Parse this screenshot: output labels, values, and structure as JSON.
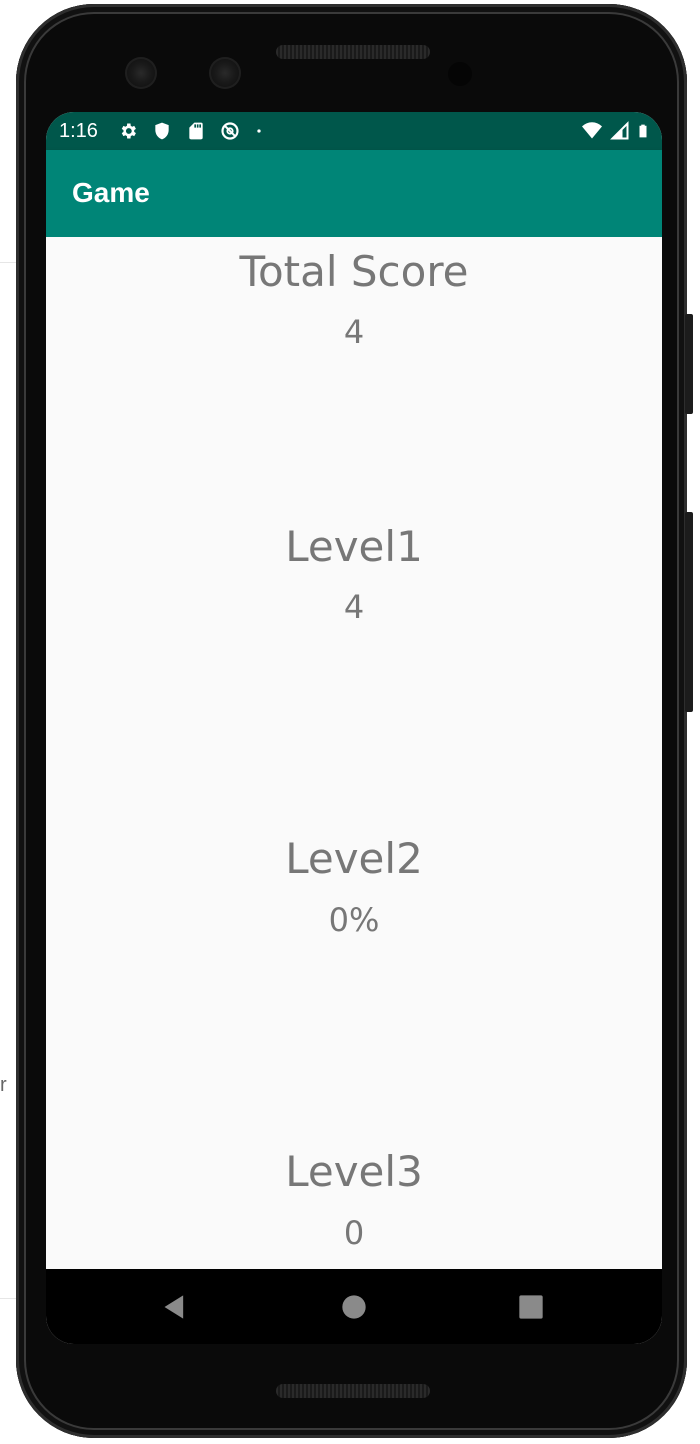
{
  "status_bar": {
    "time": "1:16",
    "icons_left": [
      "gear-icon",
      "shield-icon",
      "sd-card-icon",
      "no-sync-icon",
      "notification-dot-icon"
    ],
    "icons_right": [
      "wifi-icon",
      "cell-signal-icon",
      "battery-icon"
    ],
    "background_color": "#00574b"
  },
  "app_bar": {
    "title": "Game",
    "background_color": "#008577"
  },
  "content": {
    "total_score": {
      "label": "Total Score",
      "value": "4"
    },
    "levels": [
      {
        "label": "Level1",
        "value": "4"
      },
      {
        "label": "Level2",
        "value": "0%"
      },
      {
        "label": "Level3",
        "value": "0"
      }
    ]
  },
  "nav_bar": {
    "buttons": [
      "back-icon",
      "home-icon",
      "recents-icon"
    ]
  },
  "background": {
    "edge_letter": "r"
  }
}
